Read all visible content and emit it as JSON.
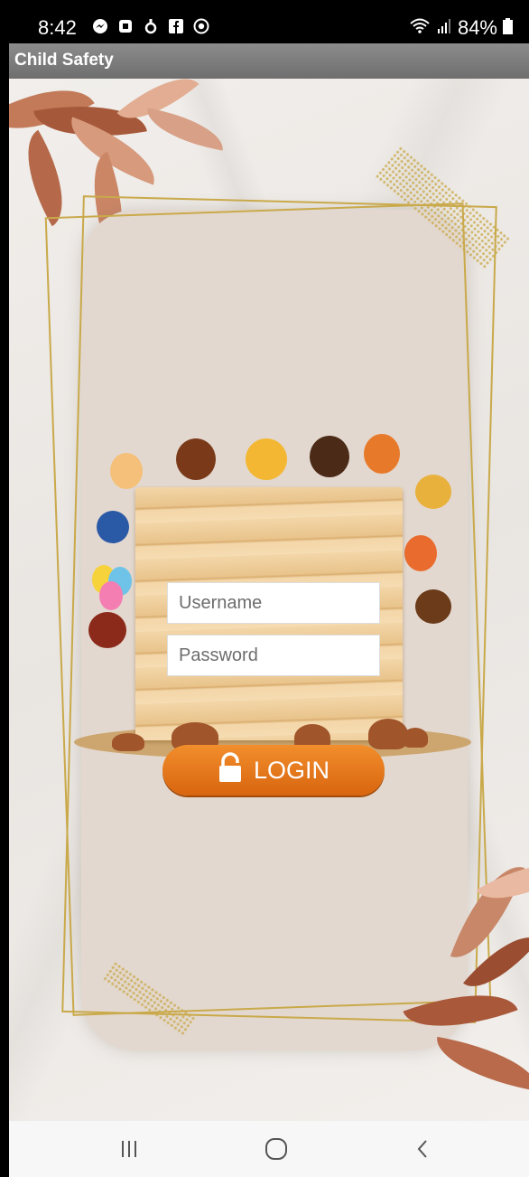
{
  "status_bar": {
    "time": "8:42",
    "battery": "84%",
    "icons": [
      "messenger-icon",
      "screen-icon",
      "location-icon",
      "facebook-icon",
      "whatsapp-icon"
    ]
  },
  "app_bar": {
    "title": "Child Safety"
  },
  "login": {
    "username_placeholder": "Username",
    "password_placeholder": "Password",
    "button_label": "LOGIN"
  },
  "nav_bar": {
    "buttons": [
      "recent-apps",
      "home",
      "back"
    ]
  },
  "colors": {
    "button": "#e8771c",
    "app_bar": "#7d7d7d",
    "card": "#e3d8cf",
    "gold": "#c9a94a"
  }
}
